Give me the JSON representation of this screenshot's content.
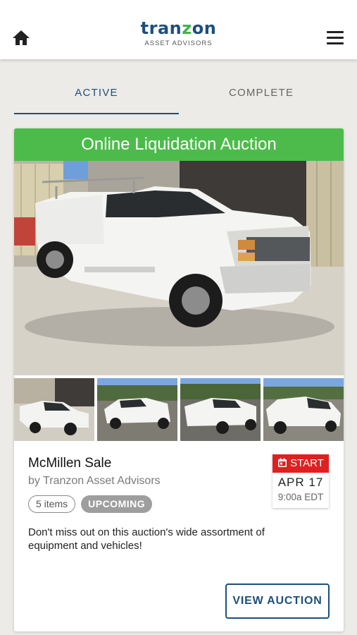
{
  "header": {
    "logo_prefix": "tran",
    "logo_z": "z",
    "logo_suffix": "on",
    "logo_sub": "ASSET ADVISORS",
    "home_icon": "home-icon",
    "menu_icon": "hamburger-menu-icon"
  },
  "tabs": [
    {
      "label": "ACTIVE",
      "selected": true
    },
    {
      "label": "COMPLETE",
      "selected": false
    }
  ],
  "auction": {
    "banner": "Online Liquidation Auction",
    "title": "McMillen Sale",
    "by": "by Tranzon Asset Advisors",
    "items_chip": "5 items",
    "status_chip": "UPCOMING",
    "start_label": "START",
    "start_date": "APR 17",
    "start_time": "9:00a EDT",
    "description": "Don't miss out on this auction's wide assortment of equipment and vehicles!",
    "button": "VIEW AUCTION",
    "photo_count": 5,
    "active_photo": 1
  },
  "colors": {
    "brand_blue": "#1d4f7c",
    "banner_green": "#4dbb4b",
    "start_red": "#e02020",
    "chip_gray": "#9e9e9e"
  }
}
